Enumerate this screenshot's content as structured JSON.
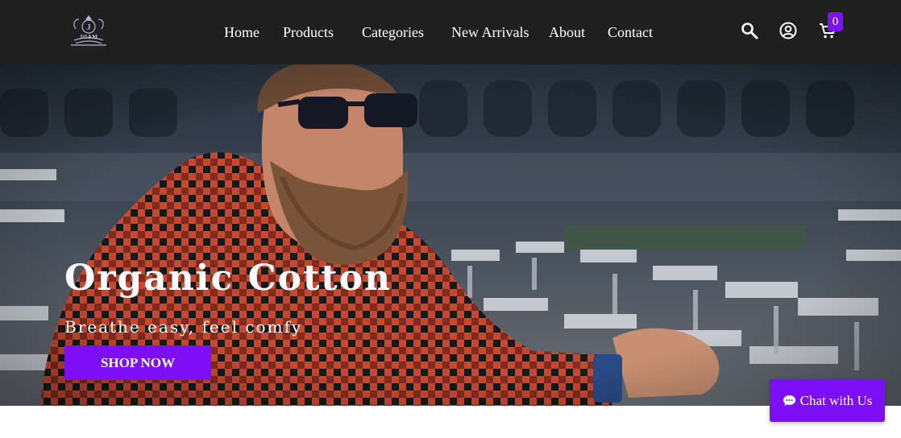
{
  "brand": {
    "logo_text": "JOAM",
    "logo_icon": "crest-logo-icon"
  },
  "nav": {
    "links": [
      "Home",
      "Products",
      "Categories",
      "New Arrivals",
      "About",
      "Contact"
    ],
    "icons": [
      "search-icon",
      "account-icon",
      "cart-icon"
    ],
    "cart_count": "0"
  },
  "hero": {
    "title": "Organic Cotton",
    "subtitle": "Breathe easy, feel comfy",
    "cta": "SHOP NOW"
  },
  "chat": {
    "label": "Chat with Us",
    "icon": "chat-bubble-icon"
  },
  "colors": {
    "navbar": "#1f1f1f",
    "accent": "#7c0ff5",
    "text": "#ffffff"
  }
}
